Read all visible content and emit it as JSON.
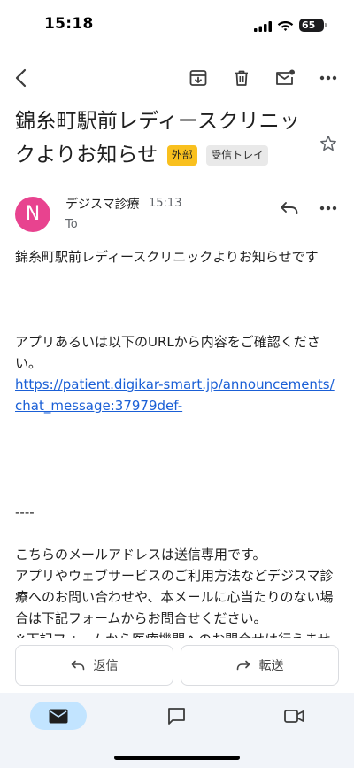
{
  "status_bar": {
    "time": "15:18",
    "battery": "65"
  },
  "toolbar": {
    "icons": [
      "back-arrow-icon",
      "archive-icon",
      "trash-icon",
      "mark-unread-icon",
      "more-vert-icon"
    ]
  },
  "email": {
    "subject": "錦糸町駅前レディースクリニックよりお知らせ",
    "labels": [
      "外部",
      "受信トレイ"
    ],
    "sender": {
      "avatar_letter": "N",
      "avatar_color": "#e8438f",
      "name": "デジスマ診療",
      "time": "15:13",
      "to": "To"
    },
    "body": {
      "line1": "錦糸町駅前レディースクリニックよりお知らせです",
      "line2": "アプリあるいは以下のURLから内容をご確認ください。",
      "link": "https://patient.digikar-smart.jp/announcements/chat_message:37979def-",
      "separator": "----",
      "line3": "こちらのメールアドレスは送信専用です。",
      "line4": "アプリやウェブサービスのご利用方法などデジスマ診療へのお問い合わせや、本メールに心当たりのない場合は下記フォームからお問合せください。",
      "line5": "※下記フォームから医療機関へのお問合せは行えません。医療機関へのお問い合わせは直接医療機関"
    }
  },
  "actions": {
    "reply": "返信",
    "forward": "転送"
  },
  "bottom_nav": {
    "items": [
      "mail-icon",
      "chat-icon",
      "video-icon"
    ],
    "active_color": "#c2e4ff"
  },
  "colors": {
    "link": "#1a5fd6",
    "external_chip": "#f9c01e"
  }
}
